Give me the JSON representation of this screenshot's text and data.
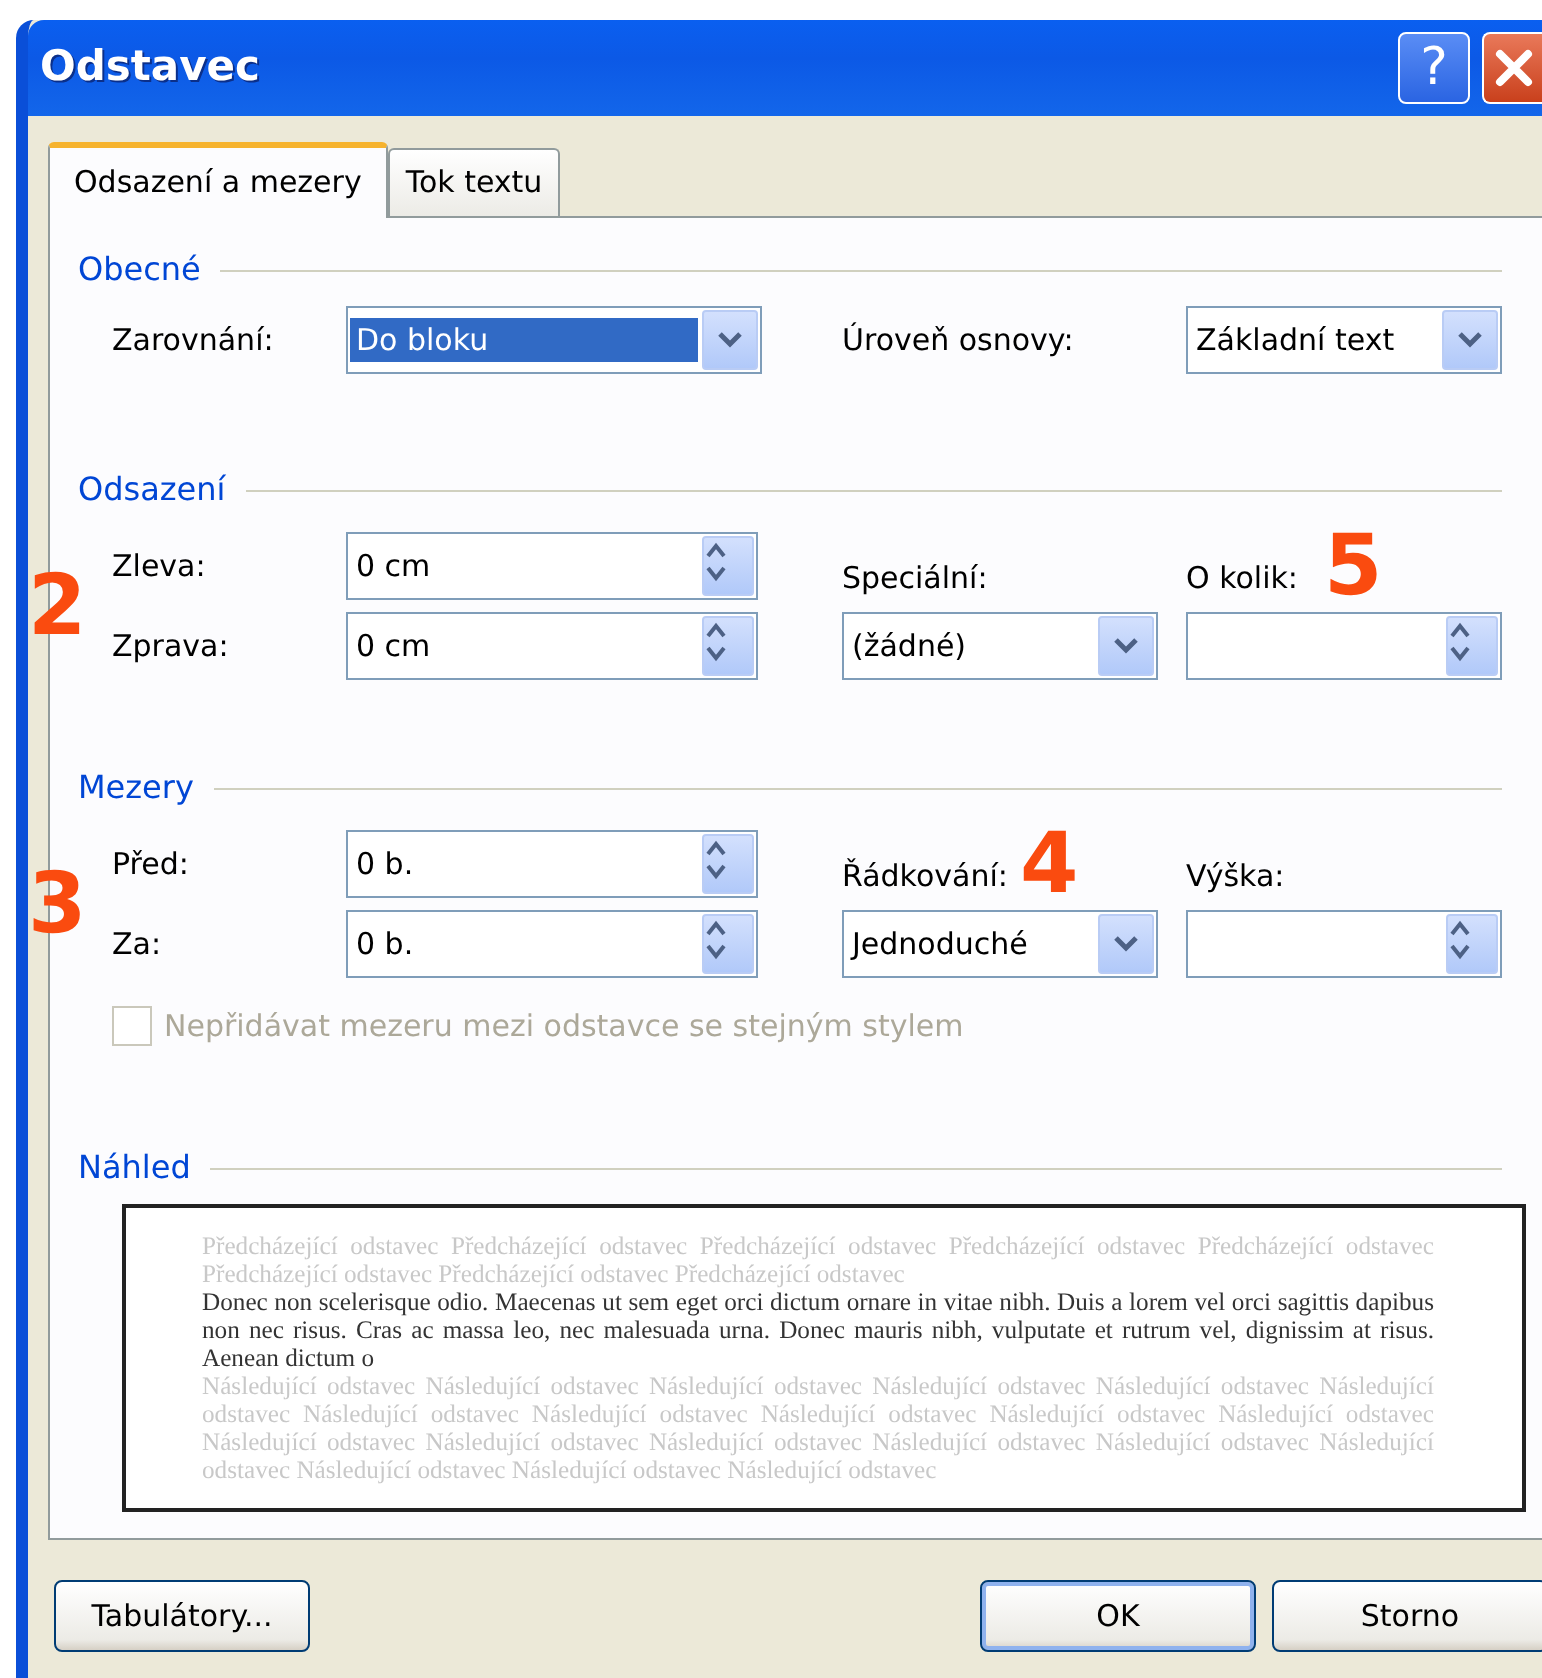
{
  "window": {
    "title": "Odstavec",
    "help_label": "?"
  },
  "tabs": [
    {
      "label": "Odsazení a mezery",
      "selected": true
    },
    {
      "label": "Tok textu",
      "selected": false
    }
  ],
  "general": {
    "title": "Obecné",
    "alignment": {
      "label": "Zarovnání:",
      "value": "Do bloku",
      "highlighted": true
    },
    "outline_level": {
      "label": "Úroveň osnovy:",
      "value": "Základní text"
    }
  },
  "indentation": {
    "title": "Odsazení",
    "marker": "2",
    "left": {
      "label": "Zleva:",
      "value": "0 cm"
    },
    "right": {
      "label": "Zprava:",
      "value": "0 cm"
    },
    "special": {
      "label": "Speciální:",
      "value": "(žádné)"
    },
    "by": {
      "label": "O kolik:",
      "marker": "5"
    }
  },
  "spacing": {
    "title": "Mezery",
    "marker": "3",
    "before": {
      "label": "Před:",
      "value": "0 b."
    },
    "after": {
      "label": "Za:",
      "value": "0 b."
    },
    "line_spacing": {
      "label": "Řádkování:",
      "value": "Jednoduché",
      "marker": "4"
    },
    "at": {
      "label": "Výška:"
    },
    "no_space_checkbox": {
      "label": "Nepřidávat mezeru mezi odstavce se stejným stylem",
      "checked": false,
      "disabled": true
    }
  },
  "preview": {
    "title": "Náhled",
    "previous_text": "Předcházející odstavec Předcházející odstavec Předcházející odstavec Předcházející odstavec Předcházející odstavec Předcházející odstavec Předcházející odstavec Předcházející odstavec",
    "current_text": "Donec non scelerisque odio. Maecenas ut sem eget orci dictum ornare in vitae nibh. Duis a lorem vel orci sagittis dapibus non nec risus. Cras ac massa leo, nec malesuada urna. Donec mauris nibh, vulputate et rutrum vel, dignissim at risus. Aenean dictum o",
    "next_text": "Následující odstavec Následující odstavec Následující odstavec Následující odstavec Následující odstavec Následující odstavec Následující odstavec Následující odstavec Následující odstavec Následující odstavec Následující odstavec Následující odstavec Následující odstavec Následující odstavec Následující odstavec Následující odstavec Následující odstavec Následující odstavec Následující odstavec Následující odstavec"
  },
  "buttons": [
    {
      "label": "Tabulátory...",
      "default": false
    },
    {
      "label": "OK",
      "default": true
    },
    {
      "label": "Storno",
      "default": false
    }
  ]
}
